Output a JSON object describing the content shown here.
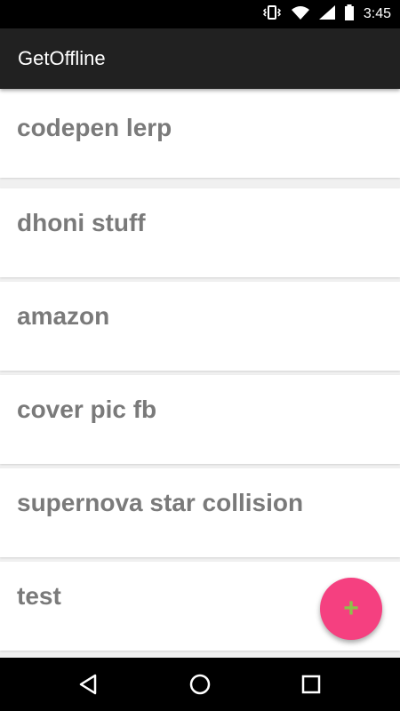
{
  "status_bar": {
    "time": "3:45",
    "icons": [
      "vibrate-icon",
      "wifi-icon",
      "signal-icon",
      "battery-icon"
    ]
  },
  "app_bar": {
    "title": "GetOffline"
  },
  "list": {
    "items": [
      {
        "title": "codepen lerp"
      },
      {
        "title": "dhoni stuff"
      },
      {
        "title": "amazon"
      },
      {
        "title": "cover pic fb"
      },
      {
        "title": "supernova star collision"
      },
      {
        "title": "test"
      }
    ]
  },
  "fab": {
    "label": "+",
    "icon": "plus-icon",
    "color": "#f54080",
    "icon_color": "#8bc34a"
  },
  "nav_bar": {
    "buttons": [
      "back-icon",
      "home-icon",
      "recents-icon"
    ]
  },
  "colors": {
    "app_bar": "#212121",
    "status_bar": "#000000",
    "card_text": "#7a7a7a",
    "background": "#f0f0f0"
  }
}
